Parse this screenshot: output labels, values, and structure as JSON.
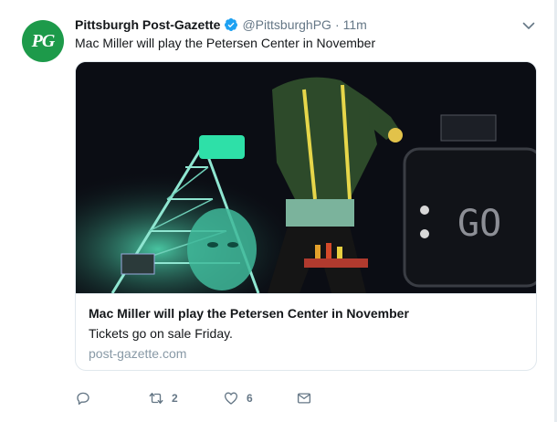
{
  "tweet": {
    "avatar_text": "PG",
    "author_name": "Pittsburgh Post-Gazette",
    "handle": "@PittsburghPG",
    "separator": "·",
    "time": "11m",
    "text": "Mac Miller will play the Petersen Center in November"
  },
  "card": {
    "image_icon": "concert-photo",
    "title": "Mac Miller will play the Petersen Center in November",
    "description": "Tickets go on sale Friday.",
    "domain": "post-gazette.com"
  },
  "actions": {
    "reply_icon": "reply-icon",
    "retweet_icon": "retweet-icon",
    "retweet_count": "2",
    "like_icon": "heart-icon",
    "like_count": "6",
    "message_icon": "envelope-icon"
  },
  "colors": {
    "accent": "#1da1f2",
    "avatar": "#1d9a4a",
    "muted": "#657786",
    "border": "#e1e8ed",
    "background": "#e6ecf0"
  }
}
